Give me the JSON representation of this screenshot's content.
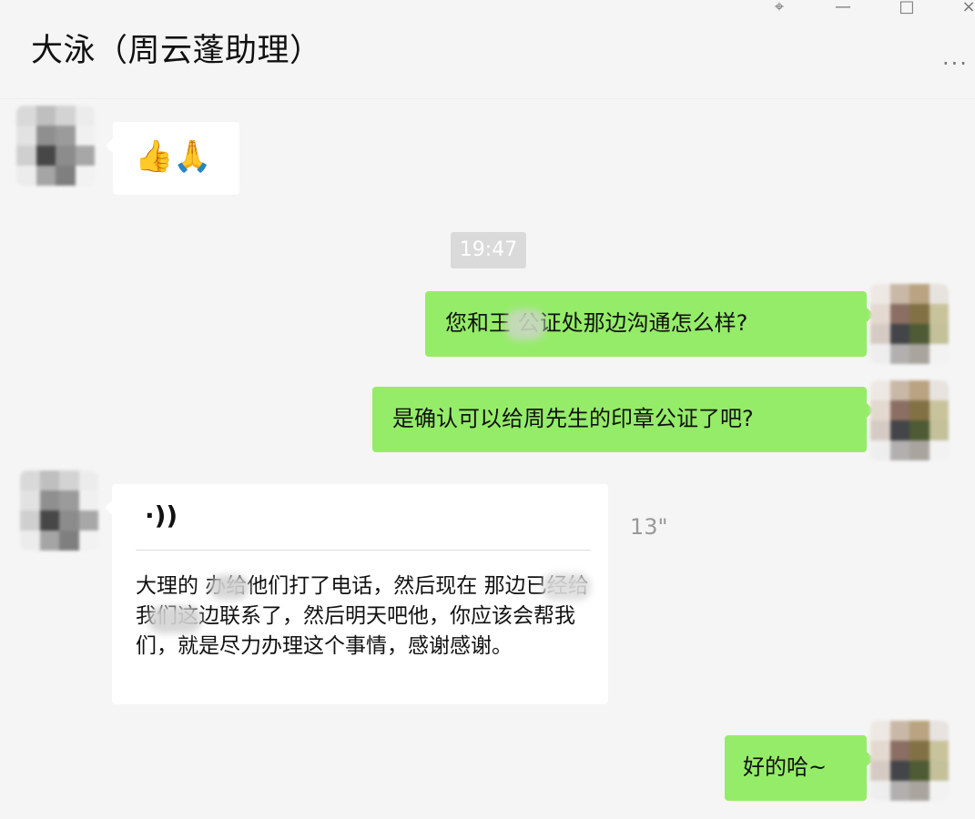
{
  "header": {
    "title": "大泳（周云蓬助理）",
    "pin_icon": "pin-icon",
    "minimize_icon": "minimize-icon",
    "maximize_icon": "maximize-icon",
    "close_icon": "close-icon",
    "more_icon": "more-icon"
  },
  "messages": {
    "emoji": "👍🙏",
    "time": "19:47",
    "sent_1": "您和王 公证处那边沟通怎么样?",
    "sent_2": "是确认可以给周先生的印章公证了吧?",
    "voice_icon": "·))",
    "voice_duration": "13\"",
    "voice_transcript": "大理的 办给他们打了电话，然后现在 那边已经给我们这边联系了，然后明天吧他，你应该会帮我们，就是尽力办理这个事情，感谢感谢。",
    "sent_3": "好的哈~"
  },
  "colors": {
    "background": "#f5f5f5",
    "sent_bubble": "#95ec69",
    "received_bubble": "#ffffff",
    "time_badge": "#dadada"
  }
}
